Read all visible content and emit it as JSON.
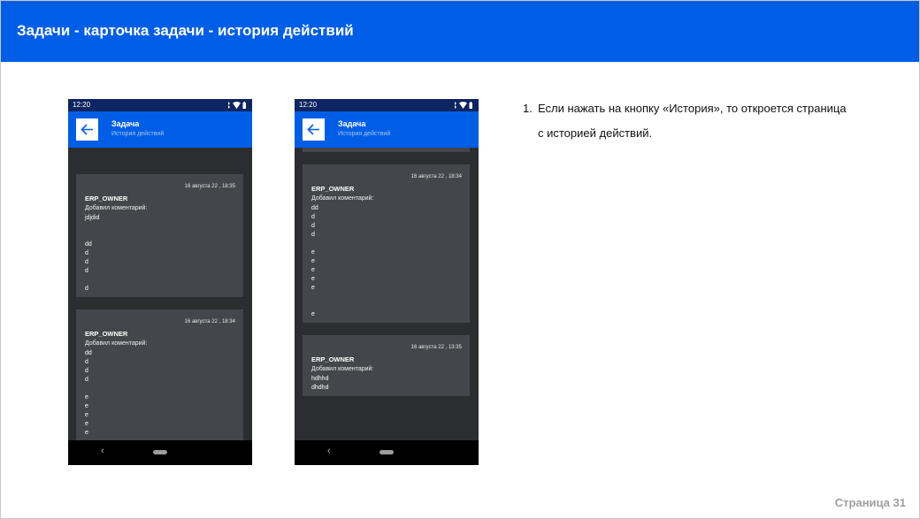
{
  "header": {
    "title": "Задачи - карточка задачи - история действий"
  },
  "phones": [
    {
      "status_time": "12:20",
      "app_title": "Задача",
      "app_subtitle": "История действий",
      "cards": [
        {
          "date": "16 августа 22 , 18:35",
          "author": "ERP_OWNER",
          "action": "Добавил коментарий:",
          "lines": [
            "jdjdid",
            "",
            "",
            "dd",
            "d",
            "d",
            "d",
            "",
            "d"
          ]
        },
        {
          "date": "16 августа 22 , 18:34",
          "author": "ERP_OWNER",
          "action": "Добавил коментарий:",
          "lines": [
            "dd",
            "d",
            "d",
            "d",
            "",
            "e",
            "e",
            "e",
            "e",
            "e"
          ]
        }
      ]
    },
    {
      "status_time": "12:20",
      "app_title": "Задача",
      "app_subtitle": "История действий",
      "cards": [
        {
          "date": "16 августа 22 , 18:34",
          "author": "ERP_OWNER",
          "action": "Добавил коментарий:",
          "lines": [
            "dd",
            "d",
            "d",
            "d",
            "",
            "e",
            "e",
            "e",
            "e",
            "e",
            "",
            "",
            "e"
          ]
        },
        {
          "date": "16 августа 22 , 13:35",
          "author": "ERP_OWNER",
          "action": "Добавил коментарий:",
          "lines": [
            "hdhhd",
            "dhdhd"
          ]
        }
      ]
    }
  ],
  "instructions": {
    "number": "1.",
    "line1": "Если нажать на кнопку «История», то откроется страница",
    "line2": "с историей действий."
  },
  "footer": {
    "page_label": "Страница 31"
  },
  "colors": {
    "brand_blue": "#005ee6",
    "status_bar": "#0d2560",
    "card_bg": "#45464c",
    "screen_bg": "#2c2d31"
  }
}
